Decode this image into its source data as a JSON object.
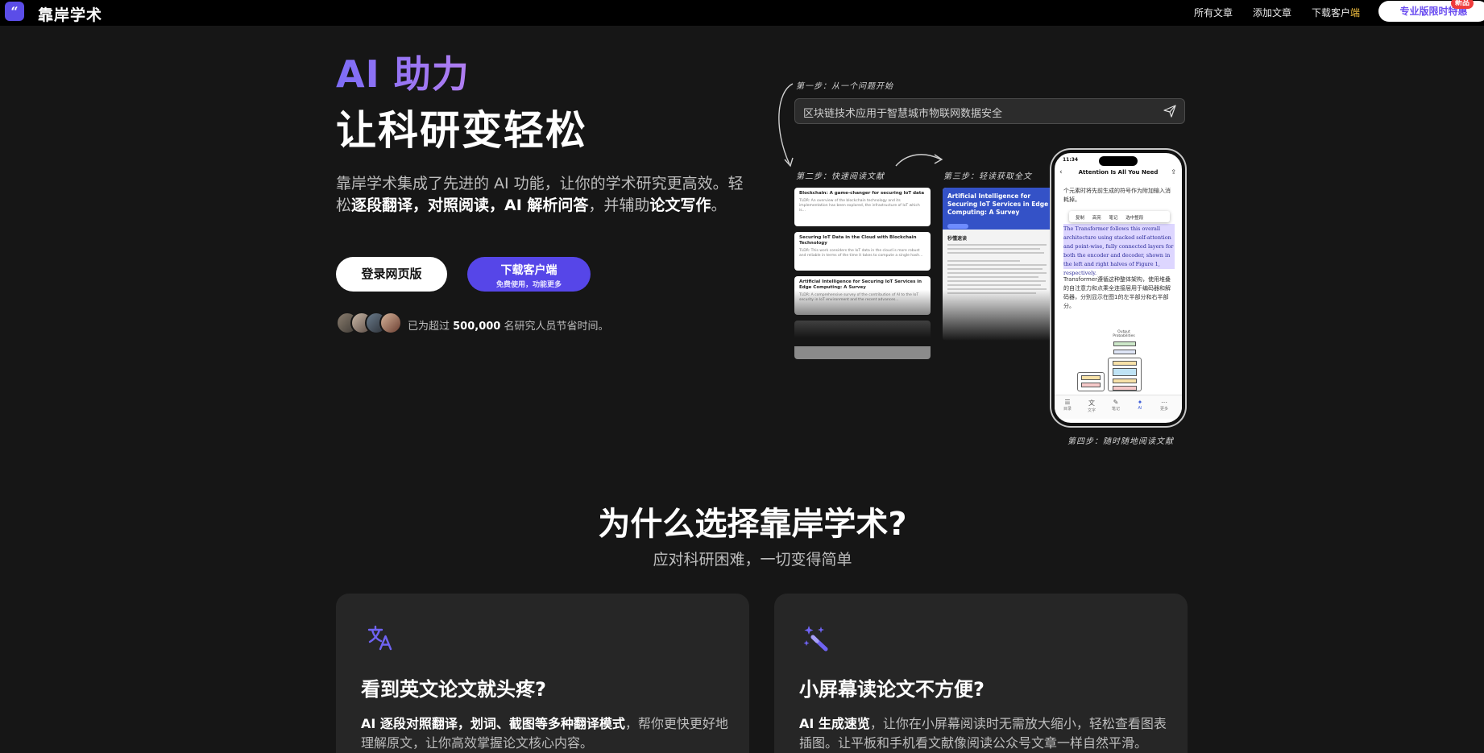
{
  "nav": {
    "logo_mark": "“",
    "brand": "靠岸学术",
    "links": [
      "所有文章",
      "添加文章"
    ],
    "download_text": "下载客户",
    "download_accent": "端",
    "pro_button": "专业版限时特惠",
    "pro_badge": "新品"
  },
  "hero": {
    "headline_ai": "AI 助力",
    "headline": "让科研变轻松",
    "desc_1": "靠岸学术集成了先进的 AI 功能，让你的学术研究更高效。轻松",
    "desc_bold_1": "逐段翻译，对照阅读，AI 解析问答",
    "desc_2": "，并辅助",
    "desc_bold_2": "论文写作",
    "desc_3": "。",
    "login_button": "登录网页版",
    "download_button": "下载客户端",
    "download_sub": "免费使用，功能更多",
    "social_prefix": "已为超过 ",
    "social_count": "500,000",
    "social_suffix": " 名研究人员节省时间。"
  },
  "illustration": {
    "step1": "第一步：从一个问题开始",
    "step2": "第二步：快速阅读文献",
    "step3": "第三步：轻读获取全文",
    "step4": "第四步：随时随地阅读文献",
    "search_text": "区块链技术应用于智慧城市物联网数据安全",
    "cards": [
      {
        "title": "Blockchain: A game-changer for securing IoT data",
        "snippet": "TLDR: An overview of the blockchain technology and its implementation has been explored, the infrastructure of IoT which is..."
      },
      {
        "title": "Securing IoT Data in the Cloud with Blockchain Technology",
        "snippet": "TLDR: This work considers the IoT data in the cloud is more robust and reliable in terms of the time it takes to compute a single hash..."
      },
      {
        "title": "Artificial Intelligence for Securing IoT Services in Edge Computing: A Survey",
        "snippet": "TLDR: A comprehensive survey of the contribution of AI to the IoT security in IoT environment and the recent advances..."
      }
    ],
    "paper_title": "Artificial Intelligence for Securing IoT Services in Edge Computing: A Survey",
    "paper_section": "秒懂速读",
    "phone": {
      "time": "11:34",
      "title": "Attention Is All You Need",
      "text_top": "个元素时将先前生成的符号作为附加输入消耗掉。",
      "menu": [
        "复制",
        "高亮",
        "笔记",
        "选中整段"
      ],
      "english": "The Transformer follows this overall architecture using stacked self-attention and point-wise, fully connected layers for both the encoder and decoder, shown in the left and right halves of Figure 1, respectively.",
      "text_bottom": "Transformer遵循这种整体架构，使用堆叠的自注意力和点乘全连接层用于编码器和解码器，分别显示在图1的左半部分和右半部分。",
      "diagram_label": "Output Probabilities",
      "tabs": [
        "目录",
        "文字",
        "笔记",
        "AI",
        "更多"
      ]
    }
  },
  "why": {
    "title": "为什么选择靠岸学术?",
    "subtitle": "应对科研困难，一切变得简单"
  },
  "features": [
    {
      "icon": "translate-icon",
      "title": "看到英文论文就头疼?",
      "desc_bold": "AI 逐段对照翻译，划词、截图等多种翻译模式",
      "desc": "，帮你更快更好地理解原文，让你高效掌握论文核心内容。"
    },
    {
      "icon": "magic-wand-icon",
      "title": "小屏幕读论文不方便?",
      "desc_bold": "AI 生成速览",
      "desc": "，让你在小屏幕阅读时无需放大缩小，轻松查看图表插图。让平板和手机看文献像阅读公众号文章一样自然平滑。"
    }
  ],
  "colors": {
    "accent": "#5646e8",
    "accent_gradient_start": "#7d6cf6",
    "accent_gradient_end": "#b17ef2",
    "background": "#161616",
    "card": "#262626",
    "badge": "#ef3b3b"
  }
}
